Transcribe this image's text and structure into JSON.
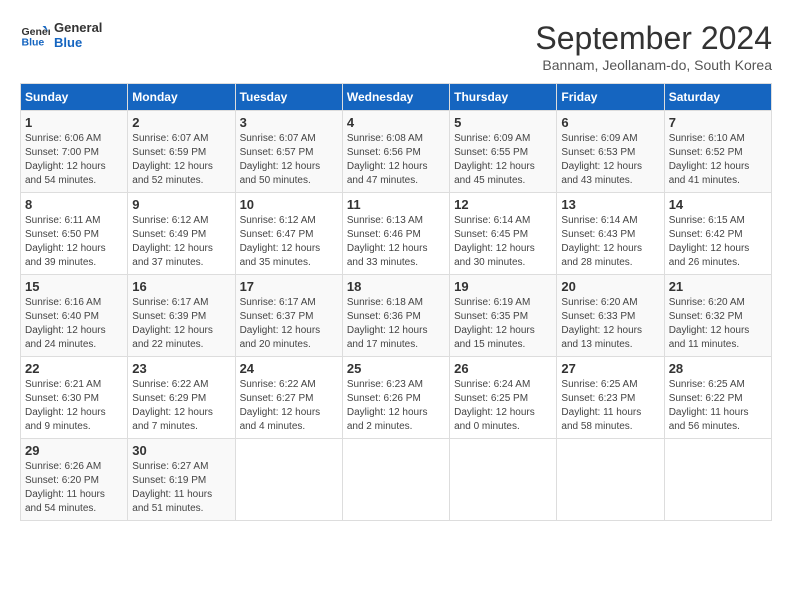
{
  "logo": {
    "text_general": "General",
    "text_blue": "Blue"
  },
  "title": "September 2024",
  "subtitle": "Bannam, Jeollanam-do, South Korea",
  "weekdays": [
    "Sunday",
    "Monday",
    "Tuesday",
    "Wednesday",
    "Thursday",
    "Friday",
    "Saturday"
  ],
  "weeks": [
    [
      {
        "day": "1",
        "info": "Sunrise: 6:06 AM\nSunset: 7:00 PM\nDaylight: 12 hours\nand 54 minutes."
      },
      {
        "day": "2",
        "info": "Sunrise: 6:07 AM\nSunset: 6:59 PM\nDaylight: 12 hours\nand 52 minutes."
      },
      {
        "day": "3",
        "info": "Sunrise: 6:07 AM\nSunset: 6:57 PM\nDaylight: 12 hours\nand 50 minutes."
      },
      {
        "day": "4",
        "info": "Sunrise: 6:08 AM\nSunset: 6:56 PM\nDaylight: 12 hours\nand 47 minutes."
      },
      {
        "day": "5",
        "info": "Sunrise: 6:09 AM\nSunset: 6:55 PM\nDaylight: 12 hours\nand 45 minutes."
      },
      {
        "day": "6",
        "info": "Sunrise: 6:09 AM\nSunset: 6:53 PM\nDaylight: 12 hours\nand 43 minutes."
      },
      {
        "day": "7",
        "info": "Sunrise: 6:10 AM\nSunset: 6:52 PM\nDaylight: 12 hours\nand 41 minutes."
      }
    ],
    [
      {
        "day": "8",
        "info": "Sunrise: 6:11 AM\nSunset: 6:50 PM\nDaylight: 12 hours\nand 39 minutes."
      },
      {
        "day": "9",
        "info": "Sunrise: 6:12 AM\nSunset: 6:49 PM\nDaylight: 12 hours\nand 37 minutes."
      },
      {
        "day": "10",
        "info": "Sunrise: 6:12 AM\nSunset: 6:47 PM\nDaylight: 12 hours\nand 35 minutes."
      },
      {
        "day": "11",
        "info": "Sunrise: 6:13 AM\nSunset: 6:46 PM\nDaylight: 12 hours\nand 33 minutes."
      },
      {
        "day": "12",
        "info": "Sunrise: 6:14 AM\nSunset: 6:45 PM\nDaylight: 12 hours\nand 30 minutes."
      },
      {
        "day": "13",
        "info": "Sunrise: 6:14 AM\nSunset: 6:43 PM\nDaylight: 12 hours\nand 28 minutes."
      },
      {
        "day": "14",
        "info": "Sunrise: 6:15 AM\nSunset: 6:42 PM\nDaylight: 12 hours\nand 26 minutes."
      }
    ],
    [
      {
        "day": "15",
        "info": "Sunrise: 6:16 AM\nSunset: 6:40 PM\nDaylight: 12 hours\nand 24 minutes."
      },
      {
        "day": "16",
        "info": "Sunrise: 6:17 AM\nSunset: 6:39 PM\nDaylight: 12 hours\nand 22 minutes."
      },
      {
        "day": "17",
        "info": "Sunrise: 6:17 AM\nSunset: 6:37 PM\nDaylight: 12 hours\nand 20 minutes."
      },
      {
        "day": "18",
        "info": "Sunrise: 6:18 AM\nSunset: 6:36 PM\nDaylight: 12 hours\nand 17 minutes."
      },
      {
        "day": "19",
        "info": "Sunrise: 6:19 AM\nSunset: 6:35 PM\nDaylight: 12 hours\nand 15 minutes."
      },
      {
        "day": "20",
        "info": "Sunrise: 6:20 AM\nSunset: 6:33 PM\nDaylight: 12 hours\nand 13 minutes."
      },
      {
        "day": "21",
        "info": "Sunrise: 6:20 AM\nSunset: 6:32 PM\nDaylight: 12 hours\nand 11 minutes."
      }
    ],
    [
      {
        "day": "22",
        "info": "Sunrise: 6:21 AM\nSunset: 6:30 PM\nDaylight: 12 hours\nand 9 minutes."
      },
      {
        "day": "23",
        "info": "Sunrise: 6:22 AM\nSunset: 6:29 PM\nDaylight: 12 hours\nand 7 minutes."
      },
      {
        "day": "24",
        "info": "Sunrise: 6:22 AM\nSunset: 6:27 PM\nDaylight: 12 hours\nand 4 minutes."
      },
      {
        "day": "25",
        "info": "Sunrise: 6:23 AM\nSunset: 6:26 PM\nDaylight: 12 hours\nand 2 minutes."
      },
      {
        "day": "26",
        "info": "Sunrise: 6:24 AM\nSunset: 6:25 PM\nDaylight: 12 hours\nand 0 minutes."
      },
      {
        "day": "27",
        "info": "Sunrise: 6:25 AM\nSunset: 6:23 PM\nDaylight: 11 hours\nand 58 minutes."
      },
      {
        "day": "28",
        "info": "Sunrise: 6:25 AM\nSunset: 6:22 PM\nDaylight: 11 hours\nand 56 minutes."
      }
    ],
    [
      {
        "day": "29",
        "info": "Sunrise: 6:26 AM\nSunset: 6:20 PM\nDaylight: 11 hours\nand 54 minutes."
      },
      {
        "day": "30",
        "info": "Sunrise: 6:27 AM\nSunset: 6:19 PM\nDaylight: 11 hours\nand 51 minutes."
      },
      {
        "day": "",
        "info": ""
      },
      {
        "day": "",
        "info": ""
      },
      {
        "day": "",
        "info": ""
      },
      {
        "day": "",
        "info": ""
      },
      {
        "day": "",
        "info": ""
      }
    ]
  ]
}
